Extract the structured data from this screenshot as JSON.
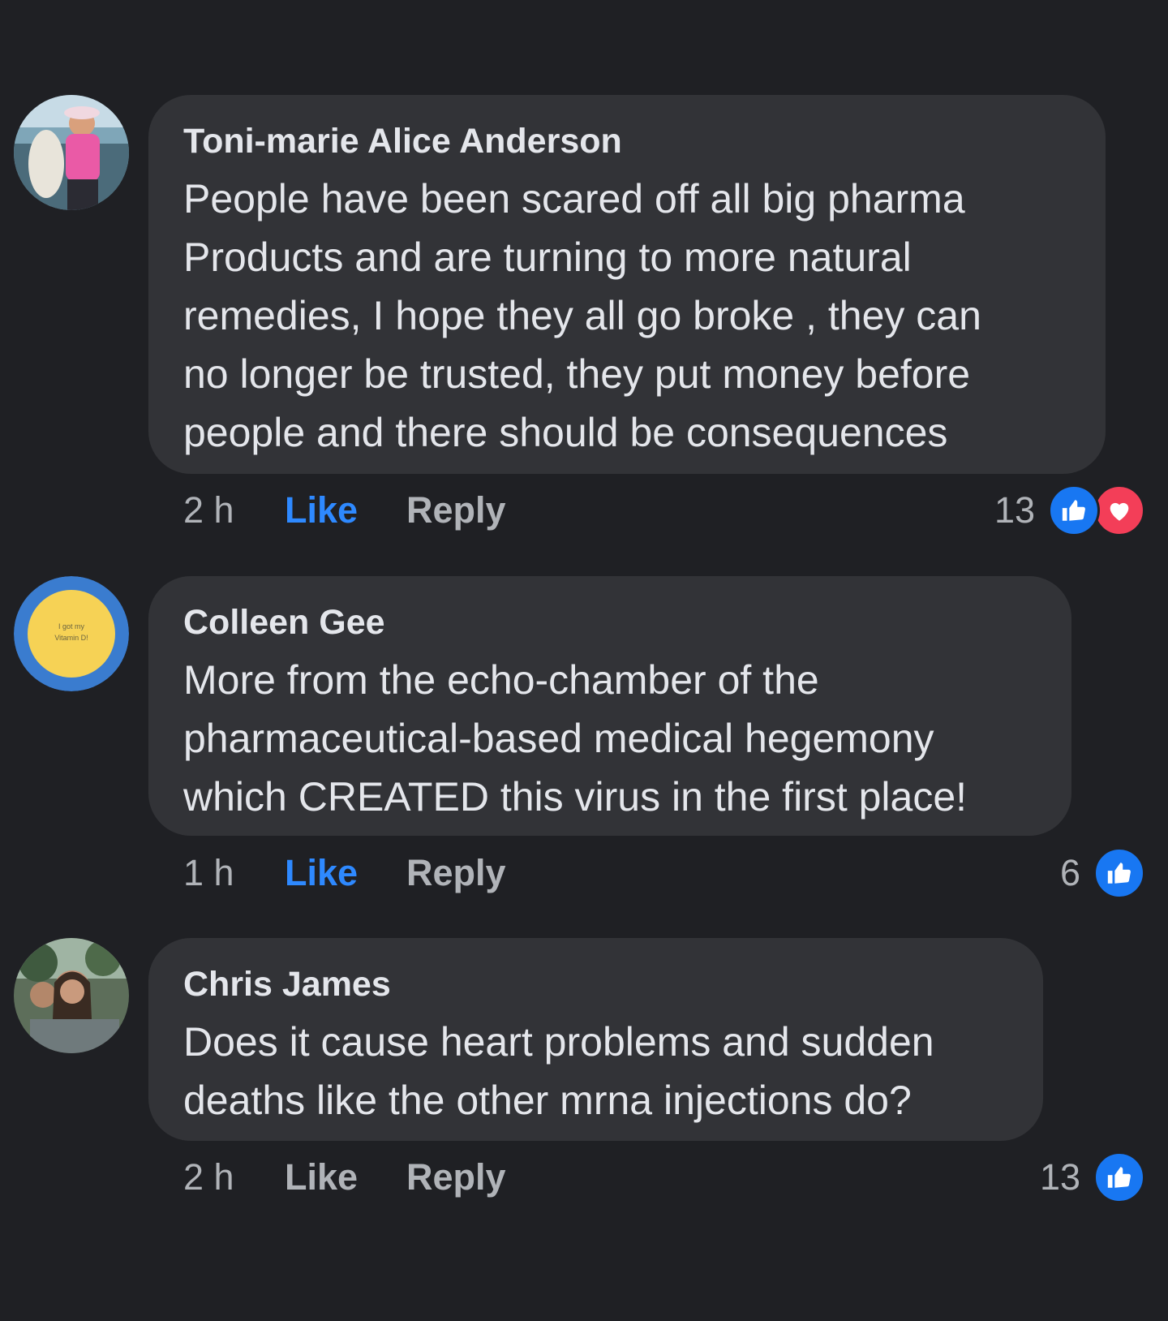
{
  "comments": [
    {
      "author": "Toni-marie Alice Anderson",
      "lines": [
        "People have been scared off all big pharma",
        "Products and are turning to more natural",
        "remedies, I hope they all go broke , they can",
        "no longer be trusted, they put  money before",
        "people and there should be consequences"
      ],
      "time": "2 h",
      "like_label": "Like",
      "reply_label": "Reply",
      "reaction_count": "13",
      "reactions": [
        "thumbs-up-icon",
        "heart-icon"
      ],
      "liked": true
    },
    {
      "author": "Colleen Gee",
      "avatar_text_1": "I got my",
      "avatar_text_2": "Vitamin D!",
      "lines": [
        "More from the echo-chamber of the",
        "pharmaceutical-based medical hegemony",
        "which CREATED this virus in the first place!"
      ],
      "time": "1 h",
      "like_label": "Like",
      "reply_label": "Reply",
      "reaction_count": "6",
      "reactions": [
        "thumbs-up-icon"
      ],
      "liked": true
    },
    {
      "author": "Chris James",
      "lines": [
        "Does it cause heart problems and sudden",
        "deaths like the other mrna injections do?"
      ],
      "time": "2 h",
      "like_label": "Like",
      "reply_label": "Reply",
      "reaction_count": "13",
      "reactions": [
        "thumbs-up-icon"
      ],
      "liked": false
    }
  ],
  "colors": {
    "background": "#1f2024",
    "bubble": "#323337",
    "text": "#e4e6eb",
    "muted": "#b0b3b8",
    "like_active": "#2e89ff",
    "like_reaction": "#1877f2",
    "love_reaction": "#f33e58"
  }
}
